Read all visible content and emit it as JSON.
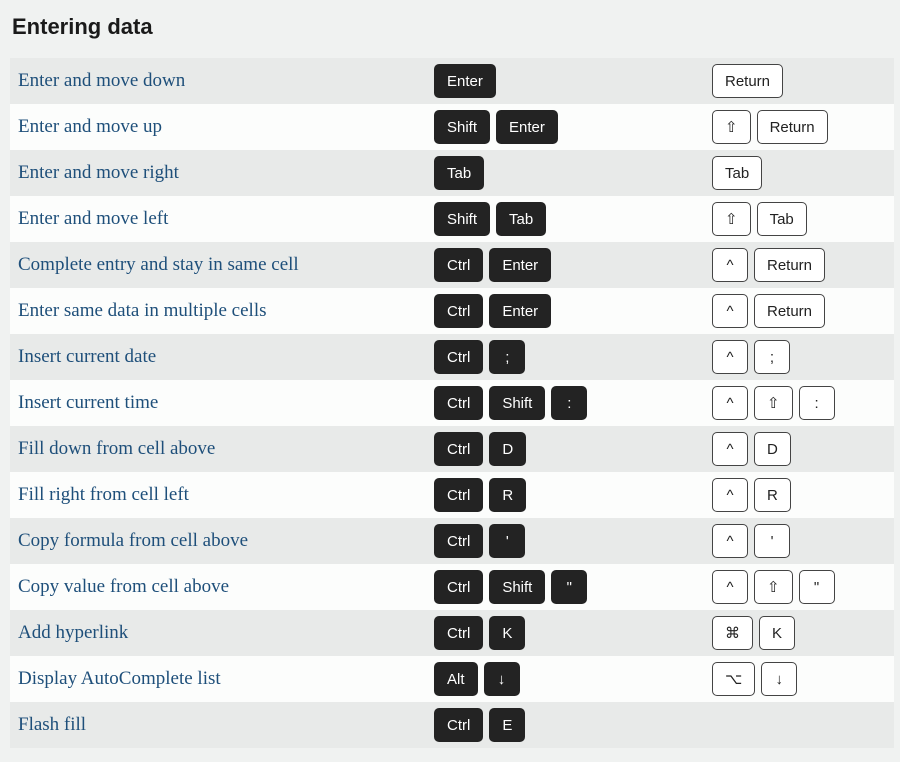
{
  "section_title": "Entering data",
  "rows": [
    {
      "name": "Enter and move down",
      "win": [
        "Enter"
      ],
      "mac": [
        "Return"
      ]
    },
    {
      "name": "Enter and move up",
      "win": [
        "Shift",
        "Enter"
      ],
      "mac": [
        "⇧",
        "Return"
      ]
    },
    {
      "name": "Enter and move right",
      "win": [
        "Tab"
      ],
      "mac": [
        "Tab"
      ]
    },
    {
      "name": "Enter and move left",
      "win": [
        "Shift",
        "Tab"
      ],
      "mac": [
        "⇧",
        "Tab"
      ]
    },
    {
      "name": "Complete entry and stay in same cell",
      "win": [
        "Ctrl",
        "Enter"
      ],
      "mac": [
        "^",
        "Return"
      ]
    },
    {
      "name": "Enter same data in multiple cells",
      "win": [
        "Ctrl",
        "Enter"
      ],
      "mac": [
        "^",
        "Return"
      ]
    },
    {
      "name": "Insert current date",
      "win": [
        "Ctrl",
        ";"
      ],
      "mac": [
        "^",
        ";"
      ]
    },
    {
      "name": "Insert current time",
      "win": [
        "Ctrl",
        "Shift",
        ":"
      ],
      "mac": [
        "^",
        "⇧",
        ":"
      ]
    },
    {
      "name": "Fill down from cell above",
      "win": [
        "Ctrl",
        "D"
      ],
      "mac": [
        "^",
        "D"
      ]
    },
    {
      "name": "Fill right from cell left",
      "win": [
        "Ctrl",
        "R"
      ],
      "mac": [
        "^",
        "R"
      ]
    },
    {
      "name": "Copy formula from cell above",
      "win": [
        "Ctrl",
        "'"
      ],
      "mac": [
        "^",
        "'"
      ]
    },
    {
      "name": "Copy value from cell above",
      "win": [
        "Ctrl",
        "Shift",
        "\""
      ],
      "mac": [
        "^",
        "⇧",
        "\""
      ]
    },
    {
      "name": "Add hyperlink",
      "win": [
        "Ctrl",
        "K"
      ],
      "mac": [
        "⌘",
        "K"
      ]
    },
    {
      "name": "Display AutoComplete list",
      "win": [
        "Alt",
        "↓"
      ],
      "mac": [
        "⌥",
        "↓"
      ]
    },
    {
      "name": "Flash fill",
      "win": [
        "Ctrl",
        "E"
      ],
      "mac": []
    }
  ]
}
